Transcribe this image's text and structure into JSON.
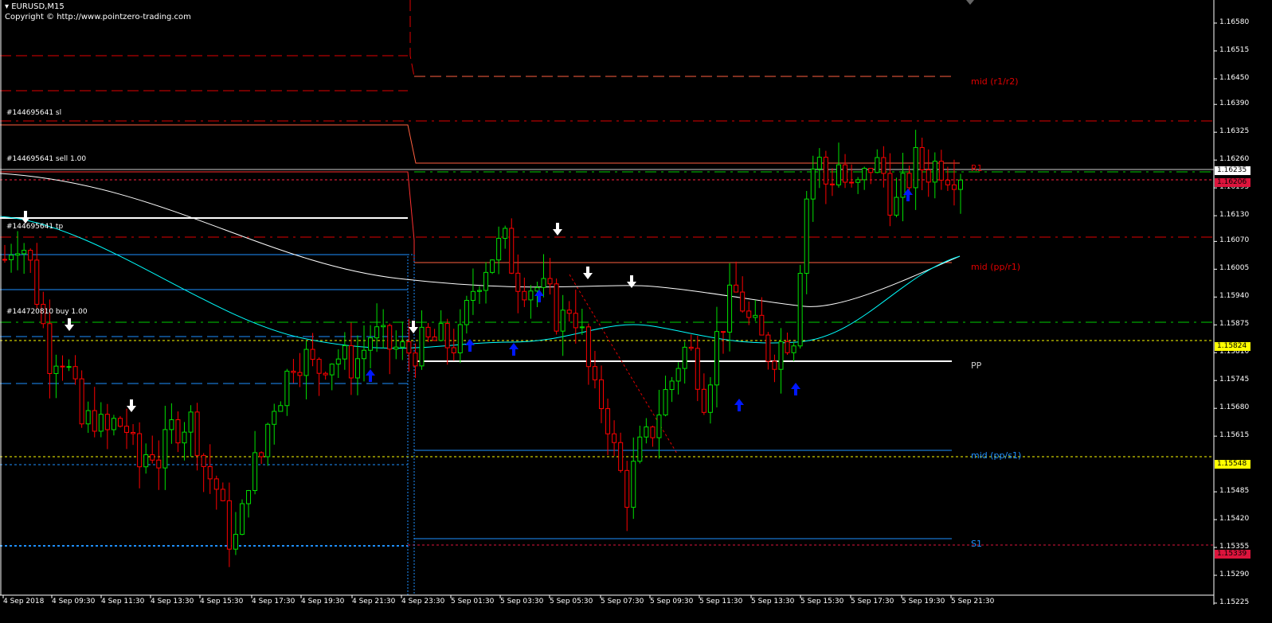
{
  "header": {
    "symbol": "EURUSD,M15",
    "copyright": "Copyright © http://www.pointzero-trading.com"
  },
  "trade_labels": [
    {
      "text": "#144695641 sl",
      "price": 1.16355
    },
    {
      "text": "#144695641 sell 1.00",
      "price": 1.16247
    },
    {
      "text": "#144695641 tp",
      "price": 1.1609
    },
    {
      "text": "#144720810  buy 1.00",
      "price": 1.1589
    }
  ],
  "pivot_labels": [
    {
      "text": "mid (r1/r2)",
      "price": 1.1644,
      "color": "#e00000"
    },
    {
      "text": "R1",
      "price": 1.16238,
      "color": "#e00000"
    },
    {
      "text": "mid (pp/r1)",
      "price": 1.16007,
      "color": "#e00000"
    },
    {
      "text": "PP",
      "price": 1.15777,
      "color": "#cccccc"
    },
    {
      "text": "mid (pp/s1)",
      "price": 1.15567,
      "color": "#1e90ff"
    },
    {
      "text": "S1",
      "price": 1.1536,
      "color": "#1e90ff"
    }
  ],
  "price_tags": [
    {
      "text": "1.16235",
      "price": 1.16235,
      "bg": "#ffffff"
    },
    {
      "text": "1.16206",
      "price": 1.16206,
      "bg": "#dc143c"
    },
    {
      "text": "1.15824",
      "price": 1.15824,
      "bg": "#ffff00"
    },
    {
      "text": "1.15548",
      "price": 1.15548,
      "bg": "#ffff00"
    },
    {
      "text": "1.15339",
      "price": 1.15339,
      "bg": "#dc143c"
    }
  ],
  "chart_data": {
    "type": "candlestick",
    "title": "EURUSD,M15",
    "ylim": [
      1.15225,
      1.1658
    ],
    "y_ticks": [
      "1.16580",
      "1.16515",
      "1.16450",
      "1.16390",
      "1.16325",
      "1.16260",
      "1.16195",
      "1.16130",
      "1.16070",
      "1.16005",
      "1.15940",
      "1.15875",
      "1.15810",
      "1.15745",
      "1.15680",
      "1.15615",
      "1.15485",
      "1.15420",
      "1.15355",
      "1.15290",
      "1.15225"
    ],
    "x_ticks": [
      "4 Sep 2018",
      "4 Sep 09:30",
      "4 Sep 11:30",
      "4 Sep 13:30",
      "4 Sep 15:30",
      "4 Sep 17:30",
      "4 Sep 19:30",
      "4 Sep 21:30",
      "4 Sep 23:30",
      "5 Sep 01:30",
      "5 Sep 03:30",
      "5 Sep 05:30",
      "5 Sep 07:30",
      "5 Sep 09:30",
      "5 Sep 11:30",
      "5 Sep 13:30",
      "5 Sep 15:30",
      "5 Sep 17:30",
      "5 Sep 19:30",
      "5 Sep 21:30"
    ],
    "closes": [
      1.16028,
      1.16085,
      1.16047,
      1.15934,
      1.15801,
      1.1582,
      1.15745,
      1.15631,
      1.15669,
      1.15612,
      1.1565,
      1.15631,
      1.15537,
      1.15593,
      1.15556,
      1.15631,
      1.1565,
      1.1565,
      1.15537,
      1.15499,
      1.15386,
      1.15367,
      1.15537,
      1.15556,
      1.15688,
      1.15726,
      1.15801,
      1.15801,
      1.15764,
      1.15801,
      1.15801,
      1.15782,
      1.15801,
      1.15858,
      1.1583,
      1.1582,
      1.15811,
      1.1582,
      1.1583,
      1.15839,
      1.1583,
      1.15839,
      1.15953,
      1.16009,
      1.16047,
      1.16066,
      1.1599,
      1.15971,
      1.15962,
      1.15934,
      1.15877,
      1.15934,
      1.15839,
      1.15707,
      1.15688,
      1.15556,
      1.1548,
      1.15575,
      1.15612,
      1.15688,
      1.15745,
      1.1582,
      1.15801,
      1.15707,
      1.15839,
      1.15915,
      1.15953,
      1.15877,
      1.15839,
      1.15801,
      1.15839,
      1.15858,
      1.1616,
      1.16274,
      1.16198,
      1.16255,
      1.16179,
      1.16198,
      1.16255,
      1.16236,
      1.16142,
      1.16198,
      1.16255,
      1.16236,
      1.16255,
      1.16236,
      1.16236
    ],
    "bull_color": "#00e000",
    "bear_color": "#ff0000",
    "grid": false
  }
}
